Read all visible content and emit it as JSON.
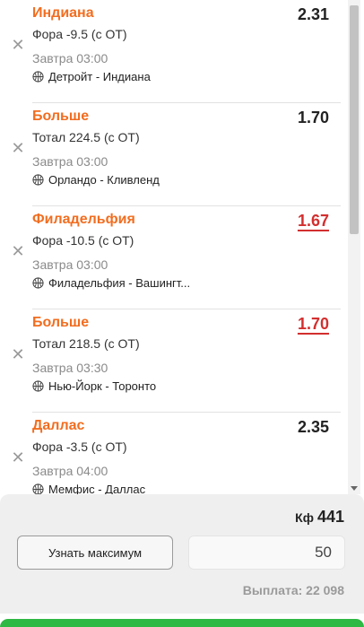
{
  "bets": [
    {
      "outcome": "Индиана",
      "odds": "2.31",
      "odds_changed": false,
      "market": "Фора -9.5 (с ОТ)",
      "time": "Завтра 03:00",
      "match": "Детройт - Индиана"
    },
    {
      "outcome": "Больше",
      "odds": "1.70",
      "odds_changed": false,
      "market": "Тотал 224.5 (с ОТ)",
      "time": "Завтра 03:00",
      "match": "Орландо - Кливленд"
    },
    {
      "outcome": "Филадельфия",
      "odds": "1.67",
      "odds_changed": true,
      "market": "Фора -10.5 (с ОТ)",
      "time": "Завтра 03:00",
      "match": "Филадельфия - Вашингт..."
    },
    {
      "outcome": "Больше",
      "odds": "1.70",
      "odds_changed": true,
      "market": "Тотал 218.5 (с ОТ)",
      "time": "Завтра 03:30",
      "match": "Нью-Йорк - Торонто"
    },
    {
      "outcome": "Даллас",
      "odds": "2.35",
      "odds_changed": false,
      "market": "Фора -3.5 (с ОТ)",
      "time": "Завтра 04:00",
      "match": "Мемфис - Даллас"
    }
  ],
  "icons": {
    "remove": "close-icon",
    "sport": "basketball-icon"
  },
  "colors": {
    "outcome": "#f26d1f",
    "changed_odds": "#d32f2f",
    "submit": "#2eb844"
  },
  "footer": {
    "coef_label": "Кф",
    "coef_value": "441",
    "max_button": "Узнать максимум",
    "stake_value": "50",
    "payout": "Выплата: 22 098"
  }
}
